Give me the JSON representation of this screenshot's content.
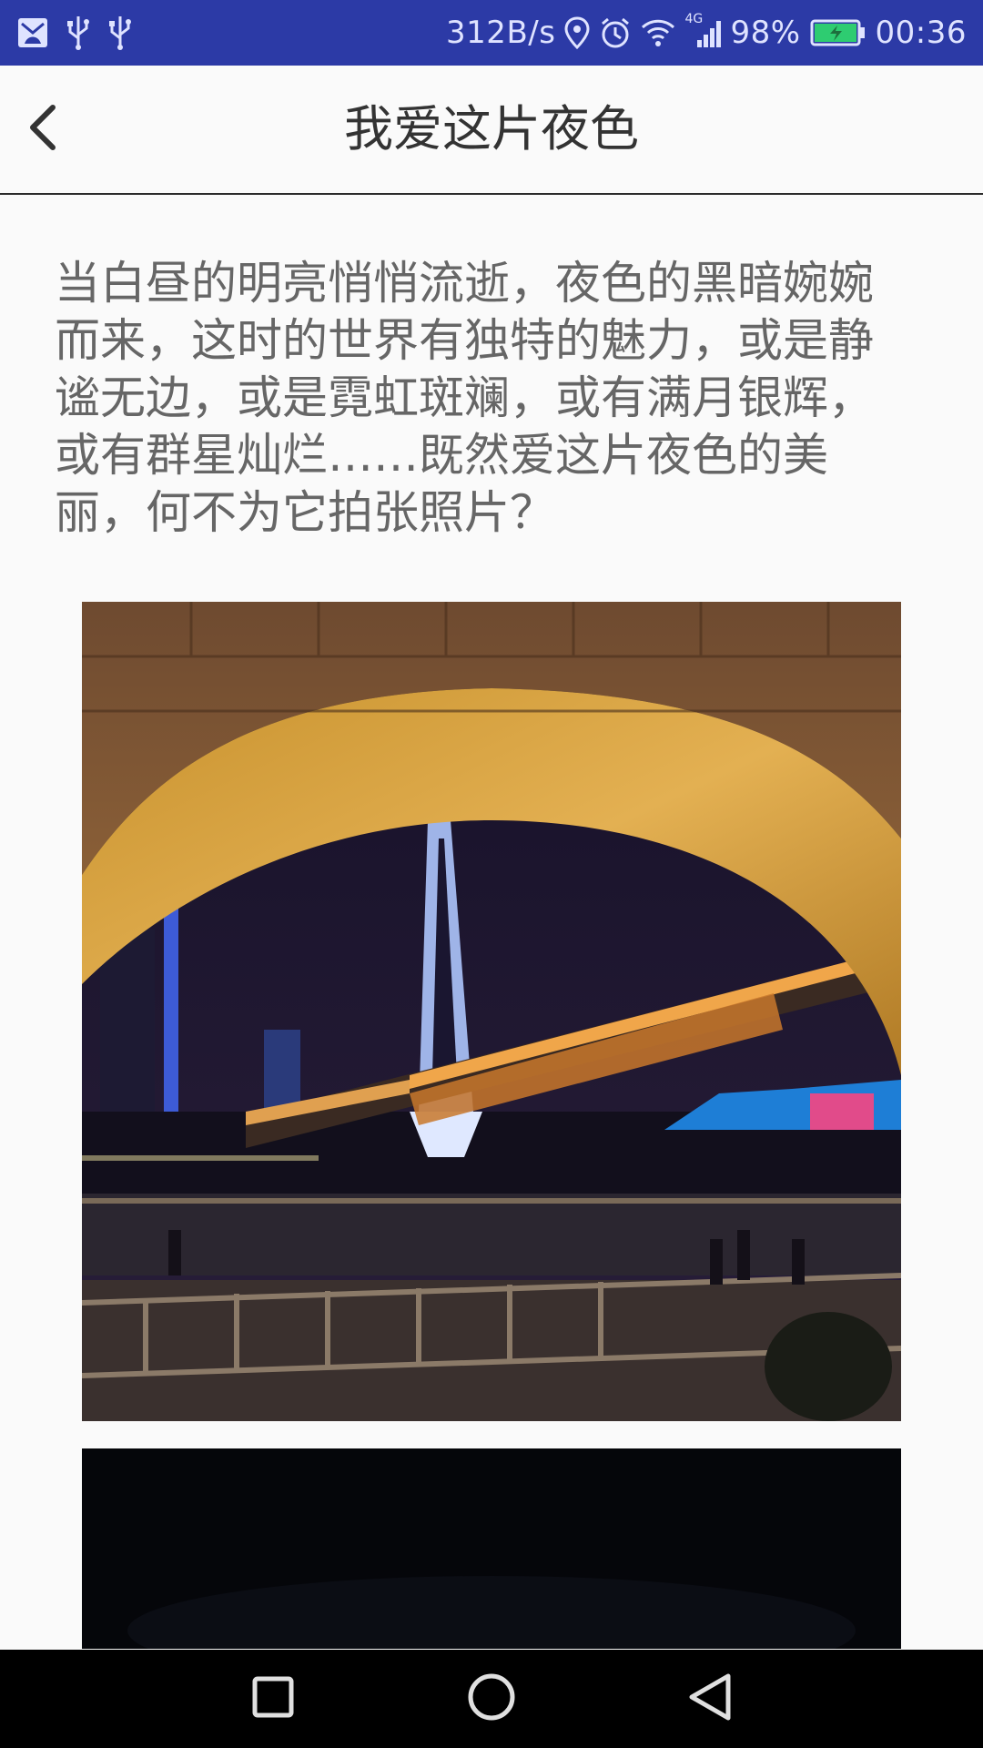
{
  "status_bar": {
    "left_icons": [
      "app-notification-icon",
      "usb-icon",
      "usb-icon"
    ],
    "network_speed": "312B/s",
    "signal_label": "4G",
    "battery_percent": "98%",
    "time": "00:36",
    "colors": {
      "background": "#2c3aa6",
      "foreground": "#dfe3ff",
      "battery": "#2ecc71"
    }
  },
  "app_bar": {
    "back_icon": "chevron-left-icon",
    "title": "我爱这片夜色"
  },
  "content": {
    "intro_text": "当白昼的明亮悄悄流逝，夜色的黑暗婉婉而来，这时的世界有独特的魅力，或是静谧无边，或是霓虹斑斓，或有满月银辉，或有群星灿烂……既然爱这片夜色的美丽，何不为它拍张照片？",
    "photos": [
      "night-bridge-under-arch-photo",
      "dark-night-photo"
    ]
  },
  "nav_bar": {
    "buttons": [
      "recents-square-icon",
      "home-circle-icon",
      "back-triangle-icon"
    ]
  }
}
